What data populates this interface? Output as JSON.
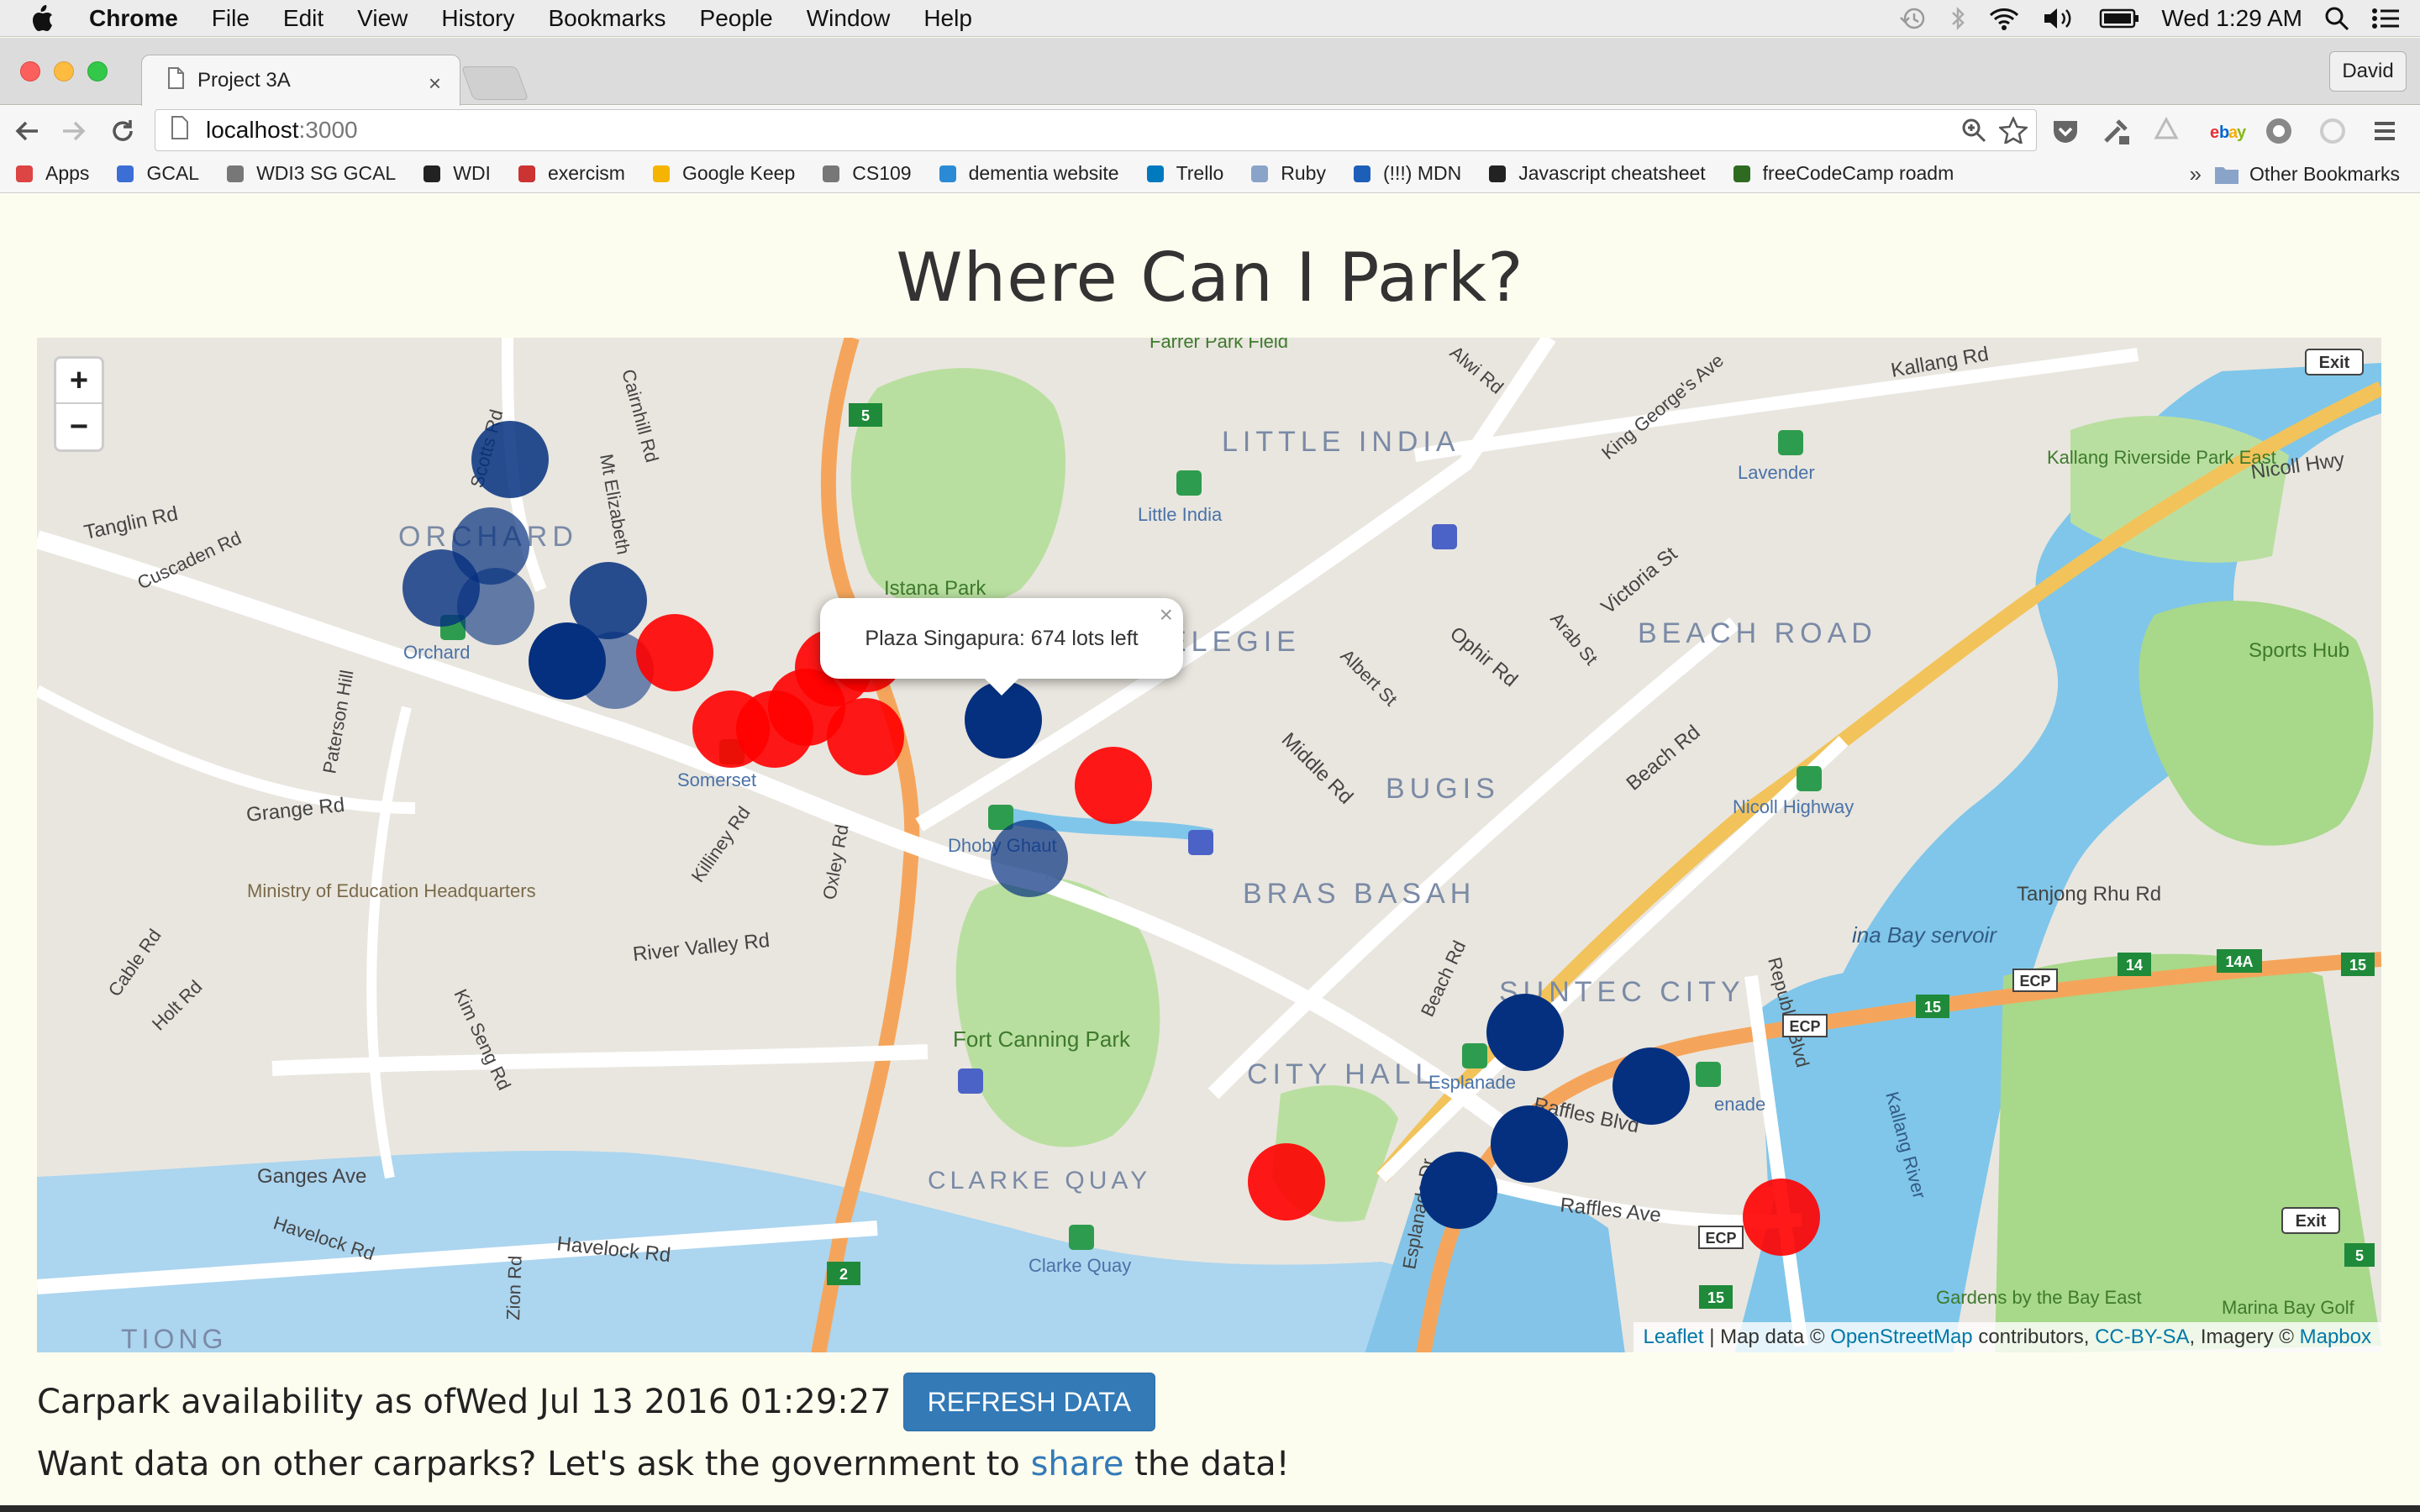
{
  "menubar": {
    "app": "Chrome",
    "items": [
      "File",
      "Edit",
      "View",
      "History",
      "Bookmarks",
      "People",
      "Window",
      "Help"
    ],
    "clock": "Wed 1:29 AM"
  },
  "tab": {
    "title": "Project 3A",
    "close": "×"
  },
  "profile": "David",
  "omnibox": {
    "host": "localhost",
    "port": ":3000"
  },
  "bookmarks": [
    {
      "label": "Apps",
      "icon": "apps-grid-icon",
      "color": "#d44"
    },
    {
      "label": "GCAL",
      "icon": "calendar-icon",
      "color": "#3b6fd6"
    },
    {
      "label": "WDI3 SG GCAL",
      "icon": "page-icon",
      "color": "#777"
    },
    {
      "label": "WDI",
      "icon": "github-icon",
      "color": "#222"
    },
    {
      "label": "exercism",
      "icon": "exercism-icon",
      "color": "#c33"
    },
    {
      "label": "Google Keep",
      "icon": "keep-icon",
      "color": "#f5b400"
    },
    {
      "label": "CS109",
      "icon": "page-icon",
      "color": "#777"
    },
    {
      "label": "dementia website",
      "icon": "star-icon",
      "color": "#2a8ad6"
    },
    {
      "label": "Trello",
      "icon": "trello-icon",
      "color": "#0079bf"
    },
    {
      "label": "Ruby",
      "icon": "folder-icon",
      "color": "#8aa3c9"
    },
    {
      "label": "(!!!) MDN",
      "icon": "mdn-icon",
      "color": "#1d5fb8"
    },
    {
      "label": "Javascript cheatsheet",
      "icon": "github-icon",
      "color": "#222"
    },
    {
      "label": "freeCodeCamp roadm",
      "icon": "fcc-icon",
      "color": "#2e6b20"
    }
  ],
  "bookmarks_overflow": "»",
  "other_bookmarks": "Other Bookmarks",
  "page": {
    "title": "Where Can I Park?",
    "status_prefix": "Carpark availability as of ",
    "status_time": "Wed Jul 13 2016 01:29:27",
    "refresh_label": "REFRESH DATA",
    "share_before": "Want data on other carparks? Let's ask the government to ",
    "share_link": "share",
    "share_after": " the data!"
  },
  "map": {
    "zoom_in": "+",
    "zoom_out": "−",
    "exit_labels": [
      "Exit",
      "Exit"
    ],
    "popup": {
      "text": "Plaza Singapura: 674 lots left",
      "close": "×"
    },
    "attribution": {
      "leaflet": "Leaflet",
      "sep1": " | Map data © ",
      "osm": "OpenStreetMap",
      "sep2": " contributors, ",
      "license": "CC-BY-SA",
      "sep3": ", Imagery © ",
      "mapbox": "Mapbox"
    },
    "district_labels": [
      "LITTLE INDIA",
      "ORCHARD",
      "BEACH ROAD",
      "BUGIS",
      "BRAS BASAH",
      "SUNTEC CITY",
      "CITY HALL",
      "CLARKE QUAY",
      "TIONG",
      "ELEGIE"
    ],
    "road_labels": [
      "Kallang Rd",
      "Tanglin Rd",
      "Cuscaden Rd",
      "Grange Rd",
      "River Valley Rd",
      "Havelock Rd",
      "Ganges Ave",
      "Victoria St",
      "Beach Rd",
      "Middle Rd",
      "Albert St",
      "Ophir Rd",
      "Arab St",
      "Raffles Blvd",
      "Raffles Ave",
      "Tanjong Rhu Rd",
      "Nicoll Hwy",
      "Republic Blvd",
      "Kallang River",
      "Scotts Rd",
      "Cairnhill Rd",
      "Mt Elizabeth",
      "Paterson Hill",
      "Killiney Rd",
      "Oxley Rd",
      "Kim Seng Rd",
      "Zion Rd",
      "Cable Rd",
      "Holt Rd",
      "King George's Ave",
      "Alwi Rd",
      "Esplanade Dr",
      "Beach Rd",
      "Havelock Rd"
    ],
    "place_labels": [
      "Istana Park",
      "Fort Canning Park",
      "Sports Hub",
      "Kallang Riverside Park East",
      "Gardens by the Bay East",
      "Marina Bay Golf",
      "Ministry of Education Headquarters",
      "Farrer Park Field",
      "ina Bay servoir"
    ],
    "station_labels": [
      "Orchard",
      "Somerset",
      "Dhoby Ghaut",
      "Little India",
      "Lavender",
      "Nicoll Highway",
      "Esplanade",
      "Clarke Quay",
      "enade"
    ],
    "route_shields": [
      "5",
      "2",
      "15",
      "14",
      "14A",
      "15",
      "ECP",
      "ECP",
      "ECP",
      "15",
      "5"
    ],
    "color_available": "#05307f",
    "color_full": "#ff0000"
  }
}
